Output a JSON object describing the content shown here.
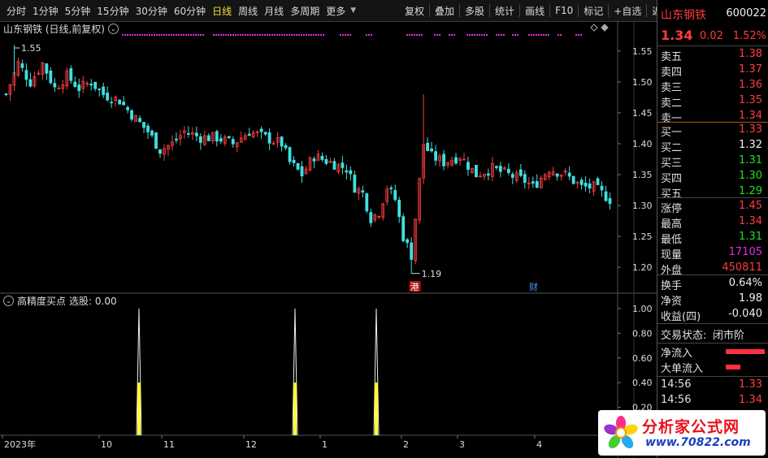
{
  "toolbar": {
    "periods": [
      "分时",
      "1分钟",
      "5分钟",
      "15分钟",
      "30分钟",
      "60分钟",
      "日线",
      "周线",
      "月线",
      "多周期",
      "更多"
    ],
    "active_period": "日线",
    "actions": [
      "复权",
      "叠加",
      "多股",
      "统计",
      "画线",
      "F10",
      "标记",
      "+自选",
      "返回"
    ]
  },
  "main_chart": {
    "title": "山东钢铁 (日线,前复权)",
    "high_label": "1.55",
    "low_label": "1.19",
    "event_markers": [
      "港",
      "财"
    ]
  },
  "indicator": {
    "title": "高精度买点",
    "signal_label": "选股: 0.00"
  },
  "x_axis": {
    "labels": [
      "2023年",
      "10",
      "11",
      "12",
      "1",
      "2",
      "3",
      "4"
    ]
  },
  "quote": {
    "name": "山东钢铁",
    "code": "600022",
    "price": "1.34",
    "change": "0.02",
    "change_pct": "1.52%",
    "asks": [
      {
        "label": "卖五",
        "price": "1.38"
      },
      {
        "label": "卖四",
        "price": "1.37"
      },
      {
        "label": "卖三",
        "price": "1.36"
      },
      {
        "label": "卖二",
        "price": "1.35"
      },
      {
        "label": "卖一",
        "price": "1.34"
      }
    ],
    "bids": [
      {
        "label": "买一",
        "price": "1.33"
      },
      {
        "label": "买二",
        "price": "1.32"
      },
      {
        "label": "买三",
        "price": "1.31"
      },
      {
        "label": "买四",
        "price": "1.30"
      },
      {
        "label": "买五",
        "price": "1.29"
      }
    ],
    "stats": [
      {
        "label": "涨停",
        "value": "1.45"
      },
      {
        "label": "最高",
        "value": "1.34"
      },
      {
        "label": "最低",
        "value": "1.31"
      },
      {
        "label": "现量",
        "value": "17105"
      },
      {
        "label": "外盘",
        "value": "450811"
      }
    ],
    "extra": [
      {
        "label": "换手",
        "value": "0.64%"
      },
      {
        "label": "净资",
        "value": "1.98"
      },
      {
        "label": "收益(四)",
        "value": "-0.040"
      }
    ],
    "trade_status_label": "交易状态:",
    "trade_status_value": "闭市阶",
    "net_inflow_label": "净流入",
    "big_order_label": "大单流入",
    "ticks": [
      {
        "time": "14:56",
        "price": "1.33"
      },
      {
        "time": "14:56",
        "price": "1.34"
      }
    ]
  },
  "watermark": {
    "line1": "分析家公式网",
    "line2": "www.70822.com"
  },
  "chart_data": [
    {
      "type": "candlestick",
      "ylim": [
        1.17,
        1.58
      ],
      "y_ticks": [
        "1.55",
        "1.50",
        "1.45",
        "1.40",
        "1.35",
        "1.30",
        "1.25",
        "1.20"
      ],
      "colors": {
        "up": "#ff3c3c",
        "down": "#40e0e0"
      }
    },
    {
      "type": "bar",
      "ylim": [
        0,
        1.0
      ],
      "y_ticks": [
        "1.00",
        "0.80",
        "0.60",
        "0.40",
        "0.20"
      ],
      "signal_peaks": [
        1.0,
        1.0,
        1.0
      ]
    }
  ]
}
